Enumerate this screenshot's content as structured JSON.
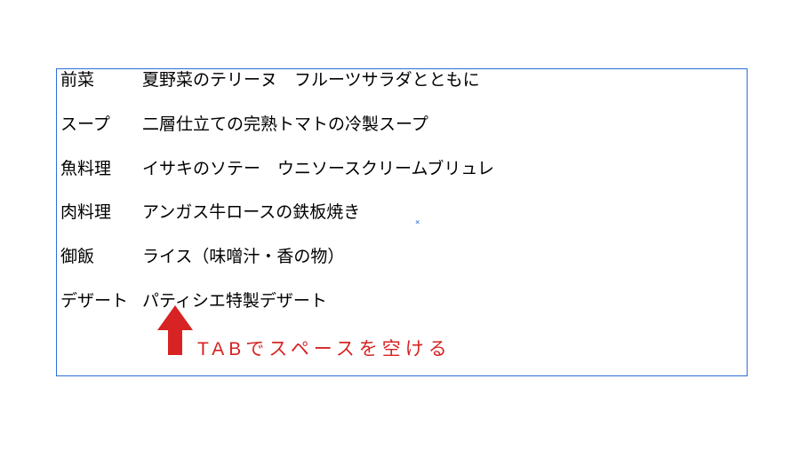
{
  "menu": {
    "rows": [
      {
        "label": "前菜",
        "desc": "夏野菜のテリーヌ　フルーツサラダとともに"
      },
      {
        "label": "スープ",
        "desc": "二層仕立ての完熟トマトの冷製スープ"
      },
      {
        "label": "魚料理",
        "desc": "イサキのソテー　ウニソースクリームブリュレ"
      },
      {
        "label": "肉料理",
        "desc": "アンガス牛ロースの鉄板焼き"
      },
      {
        "label": "御飯",
        "desc": "ライス（味噌汁・香の物）"
      },
      {
        "label": "デザート",
        "desc": "パティシエ特製デザート"
      }
    ]
  },
  "end_marker": "×",
  "annotation_text": "TABでスペースを空ける",
  "colors": {
    "arrow": "#d72323",
    "annotation": "#d72323",
    "frame_border": "#2b6fd6"
  }
}
